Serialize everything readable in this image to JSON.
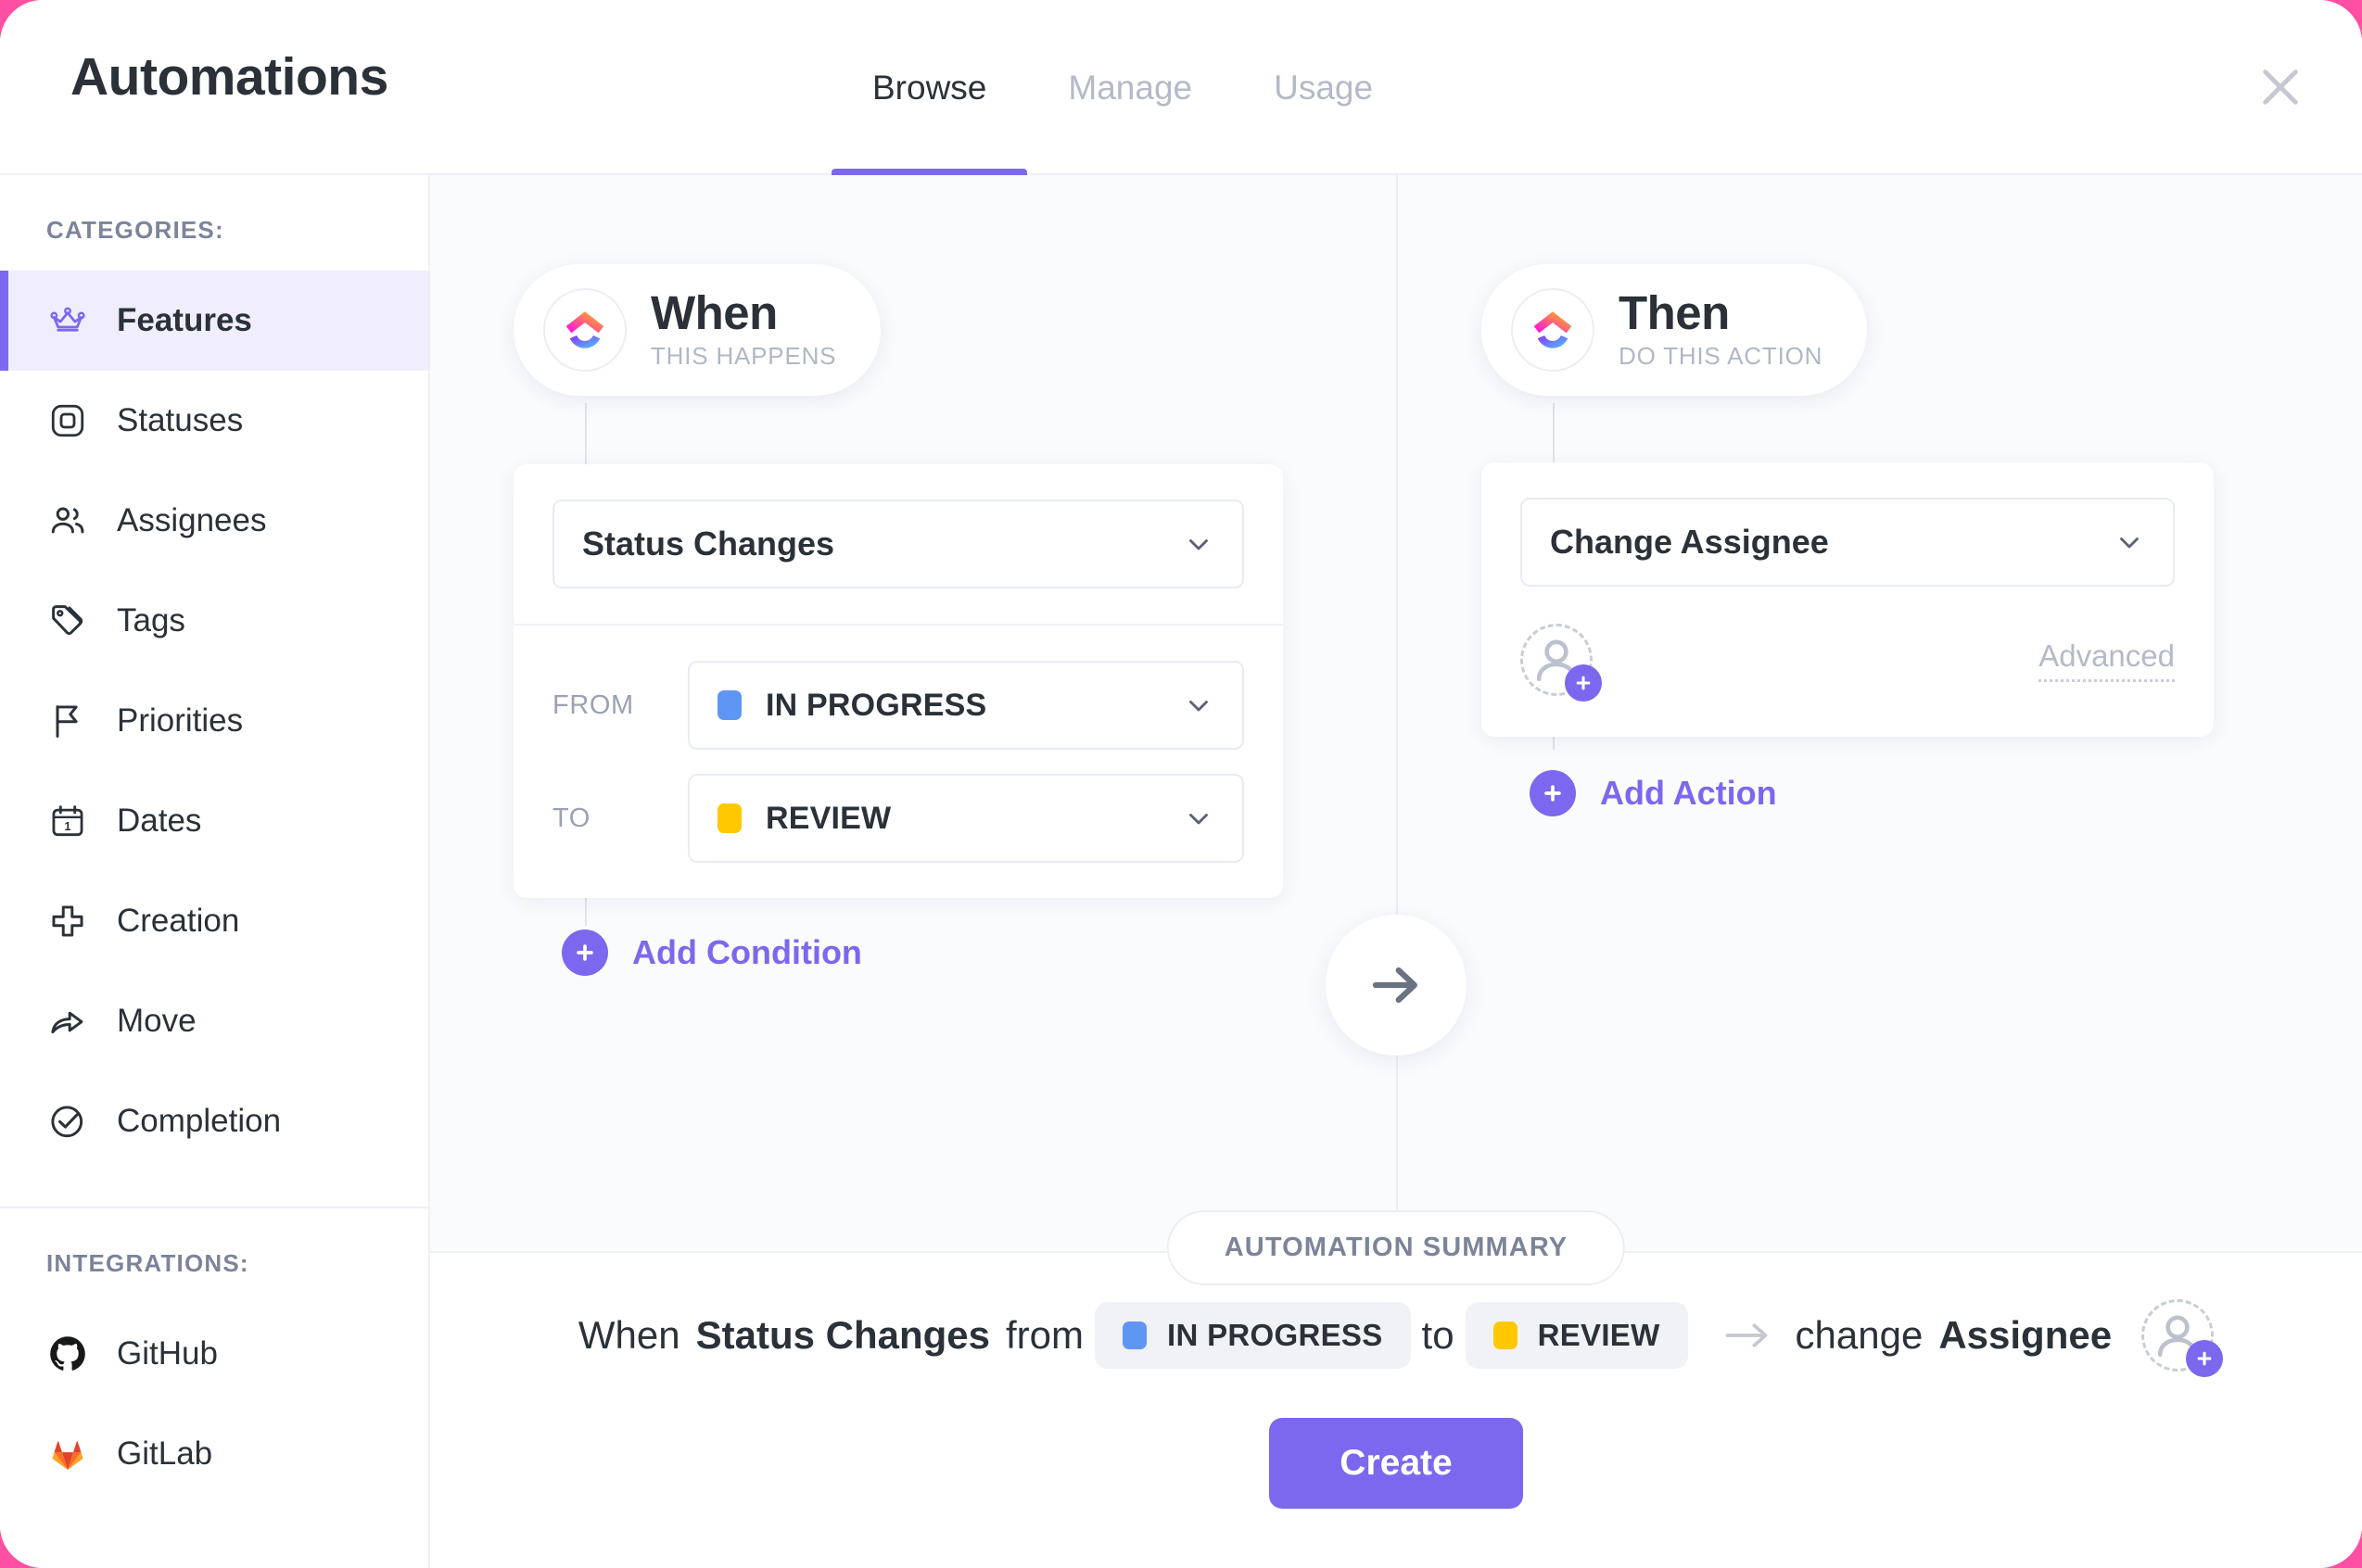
{
  "window": {
    "title": "Automations",
    "close_icon": "close-icon"
  },
  "tabs": [
    {
      "label": "Browse",
      "active": true
    },
    {
      "label": "Manage",
      "active": false
    },
    {
      "label": "Usage",
      "active": false
    }
  ],
  "sidebar": {
    "categories_heading": "CATEGORIES:",
    "integrations_heading": "INTEGRATIONS:",
    "categories": [
      {
        "label": "Features",
        "icon": "crown-icon",
        "active": true
      },
      {
        "label": "Statuses",
        "icon": "rounded-square-icon",
        "active": false
      },
      {
        "label": "Assignees",
        "icon": "people-icon",
        "active": false
      },
      {
        "label": "Tags",
        "icon": "tag-icon",
        "active": false
      },
      {
        "label": "Priorities",
        "icon": "flag-icon",
        "active": false
      },
      {
        "label": "Dates",
        "icon": "calendar-icon",
        "active": false
      },
      {
        "label": "Creation",
        "icon": "plus-icon",
        "active": false
      },
      {
        "label": "Move",
        "icon": "share-arrow-icon",
        "active": false
      },
      {
        "label": "Completion",
        "icon": "check-circle-icon",
        "active": false
      }
    ],
    "integrations": [
      {
        "label": "GitHub",
        "icon": "github-icon"
      },
      {
        "label": "GitLab",
        "icon": "gitlab-icon"
      }
    ]
  },
  "builder": {
    "when": {
      "title": "When",
      "subtitle": "THIS HAPPENS",
      "logo_icon": "clickup-logo-icon",
      "trigger": {
        "value": "Status Changes",
        "chevron_icon": "chevron-down-icon"
      },
      "conditions": [
        {
          "label": "FROM",
          "status": "IN PROGRESS",
          "color": "#5f96f3",
          "chevron_icon": "chevron-down-icon"
        },
        {
          "label": "TO",
          "status": "REVIEW",
          "color": "#ffc800",
          "chevron_icon": "chevron-down-icon"
        }
      ],
      "add_condition_label": "Add Condition",
      "add_icon": "plus-circle-icon"
    },
    "then": {
      "title": "Then",
      "subtitle": "DO THIS ACTION",
      "logo_icon": "clickup-logo-icon",
      "action": {
        "value": "Change Assignee",
        "chevron_icon": "chevron-down-icon"
      },
      "assignee_placeholder_icon": "add-assignee-avatar-icon",
      "advanced_label": "Advanced",
      "add_action_label": "Add Action",
      "add_icon": "plus-circle-icon"
    },
    "flow_arrow_icon": "arrow-right-icon"
  },
  "summary": {
    "badge": "AUTOMATION SUMMARY",
    "sentence": {
      "when_word": "When",
      "trigger": "Status Changes",
      "from_word": "from",
      "from_status": "IN PROGRESS",
      "from_color": "#5f96f3",
      "to_word": "to",
      "to_status": "REVIEW",
      "to_color": "#ffc800",
      "arrow_icon": "arrow-right-icon",
      "action_verb": "change",
      "action_target": "Assignee",
      "avatar_icon": "add-assignee-avatar-icon"
    },
    "create_button": "Create"
  },
  "colors": {
    "accent_purple": "#7b68ee",
    "in_progress": "#5f96f3",
    "review": "#ffc800",
    "backdrop_pink": "#ff4fa3"
  }
}
